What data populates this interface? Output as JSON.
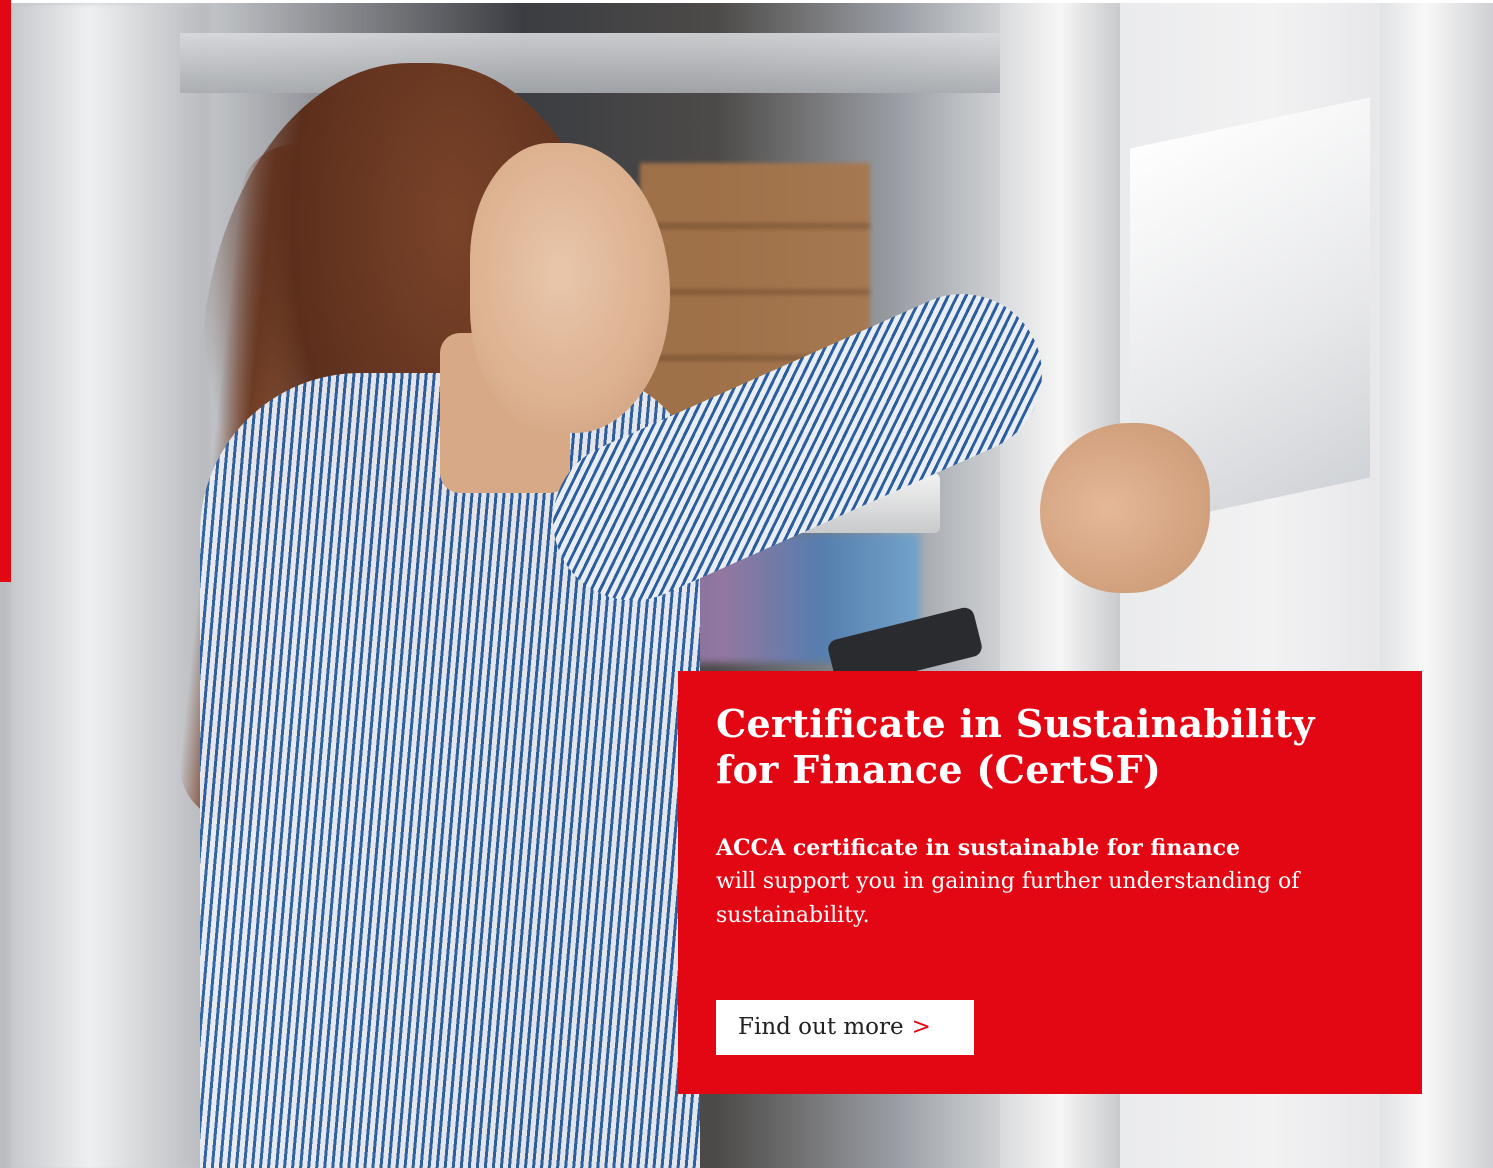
{
  "hero": {
    "image_alt": "Woman in striped blue shirt checking items on a warehouse shelf"
  },
  "card": {
    "title": "Certificate in Sustainability for Finance (CertSF)",
    "lead": "ACCA certificate in sustainable for finance",
    "body": "will support you in gaining further understanding of sustainability.",
    "cta_label": "Find out more",
    "cta_chevron": ">"
  },
  "colors": {
    "accent_red": "#e30613",
    "button_bg": "#ffffff",
    "button_text": "#222222"
  }
}
